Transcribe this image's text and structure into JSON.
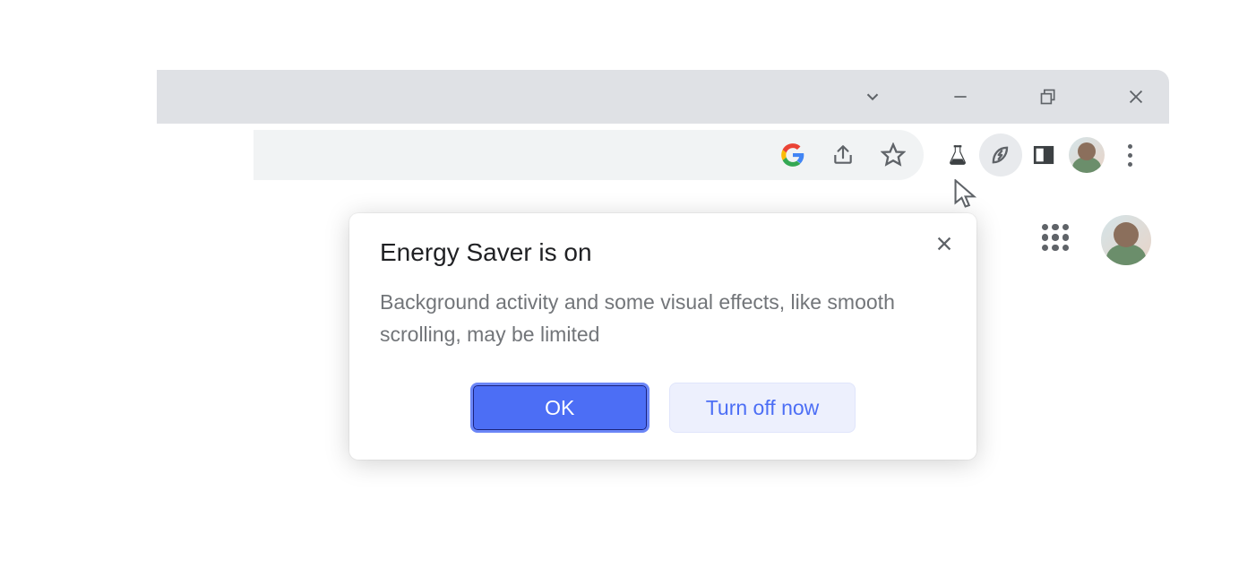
{
  "popup": {
    "title": "Energy Saver is on",
    "body": "Background activity and some visual effects, like smooth scrolling, may be limited",
    "ok_label": "OK",
    "turn_off_label": "Turn off now"
  },
  "icons": {
    "google": "google-logo-icon",
    "share": "share-icon",
    "star": "bookmark-star-icon",
    "labs": "labs-flask-icon",
    "energy": "energy-leaf-icon",
    "side_panel": "side-panel-icon",
    "avatar": "profile-avatar",
    "menu": "kebab-menu-icon",
    "minimize": "minimize-icon",
    "maximize": "maximize-restore-icon",
    "close_window": "close-window-icon",
    "chevron": "chevron-down-icon",
    "apps": "apps-grid-icon",
    "close_popup": "close-icon"
  }
}
